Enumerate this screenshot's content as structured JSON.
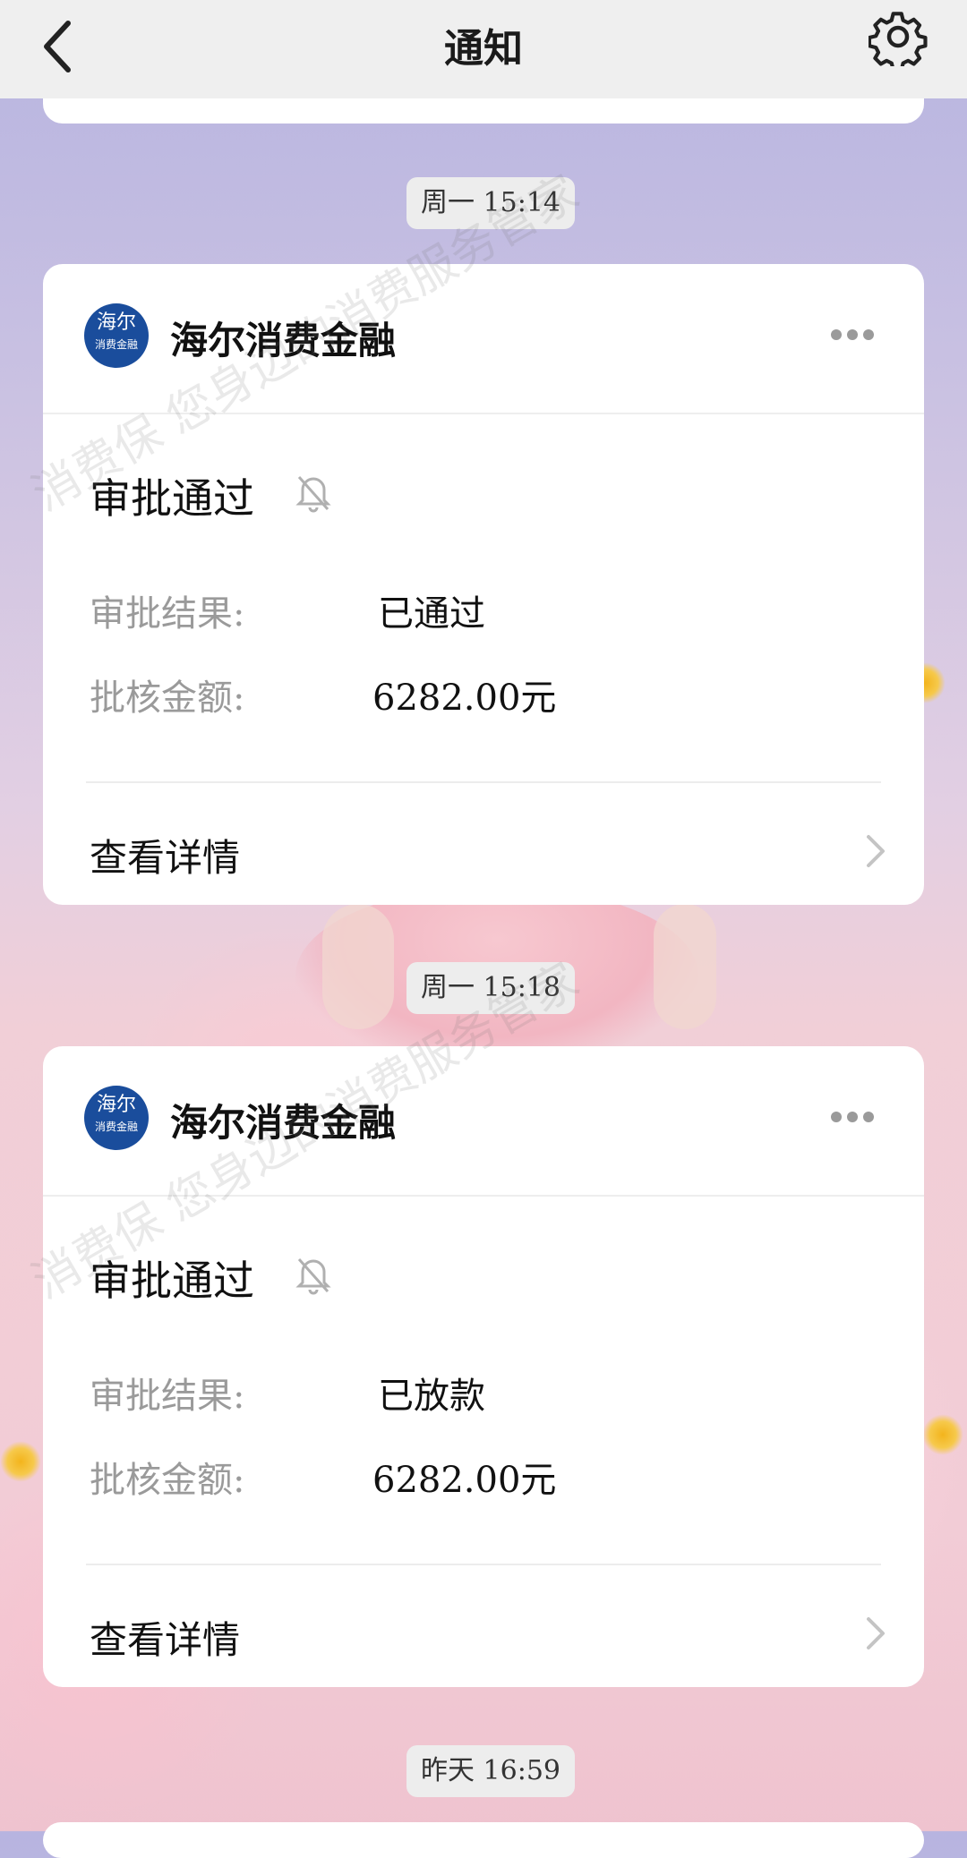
{
  "header": {
    "title": "通知",
    "back_icon": "chevron-left-icon",
    "settings_icon": "gear-icon"
  },
  "notifications": [
    {
      "time": "周一 15:14",
      "sender": "海尔消费金融",
      "logo_text_top": "海尔",
      "logo_text_bottom": "消费金融",
      "title": "审批通过",
      "rows": [
        {
          "label": "审批结果:",
          "value": "已通过"
        },
        {
          "label": "批核金额:",
          "value": "6282.00元"
        }
      ],
      "detail_label": "查看详情"
    },
    {
      "time": "周一 15:18",
      "sender": "海尔消费金融",
      "logo_text_top": "海尔",
      "logo_text_bottom": "消费金融",
      "title": "审批通过",
      "rows": [
        {
          "label": "审批结果:",
          "value": "已放款"
        },
        {
          "label": "批核金额:",
          "value": "6282.00元"
        }
      ],
      "detail_label": "查看详情"
    }
  ],
  "next_time": "昨天 16:59",
  "watermark": {
    "lines": [
      "消费保 您身边的消费服务管家"
    ]
  },
  "colors": {
    "brand_blue": "#1a4d9c",
    "label_gray": "#9a9a9a",
    "topbar_bg": "#efefef"
  }
}
